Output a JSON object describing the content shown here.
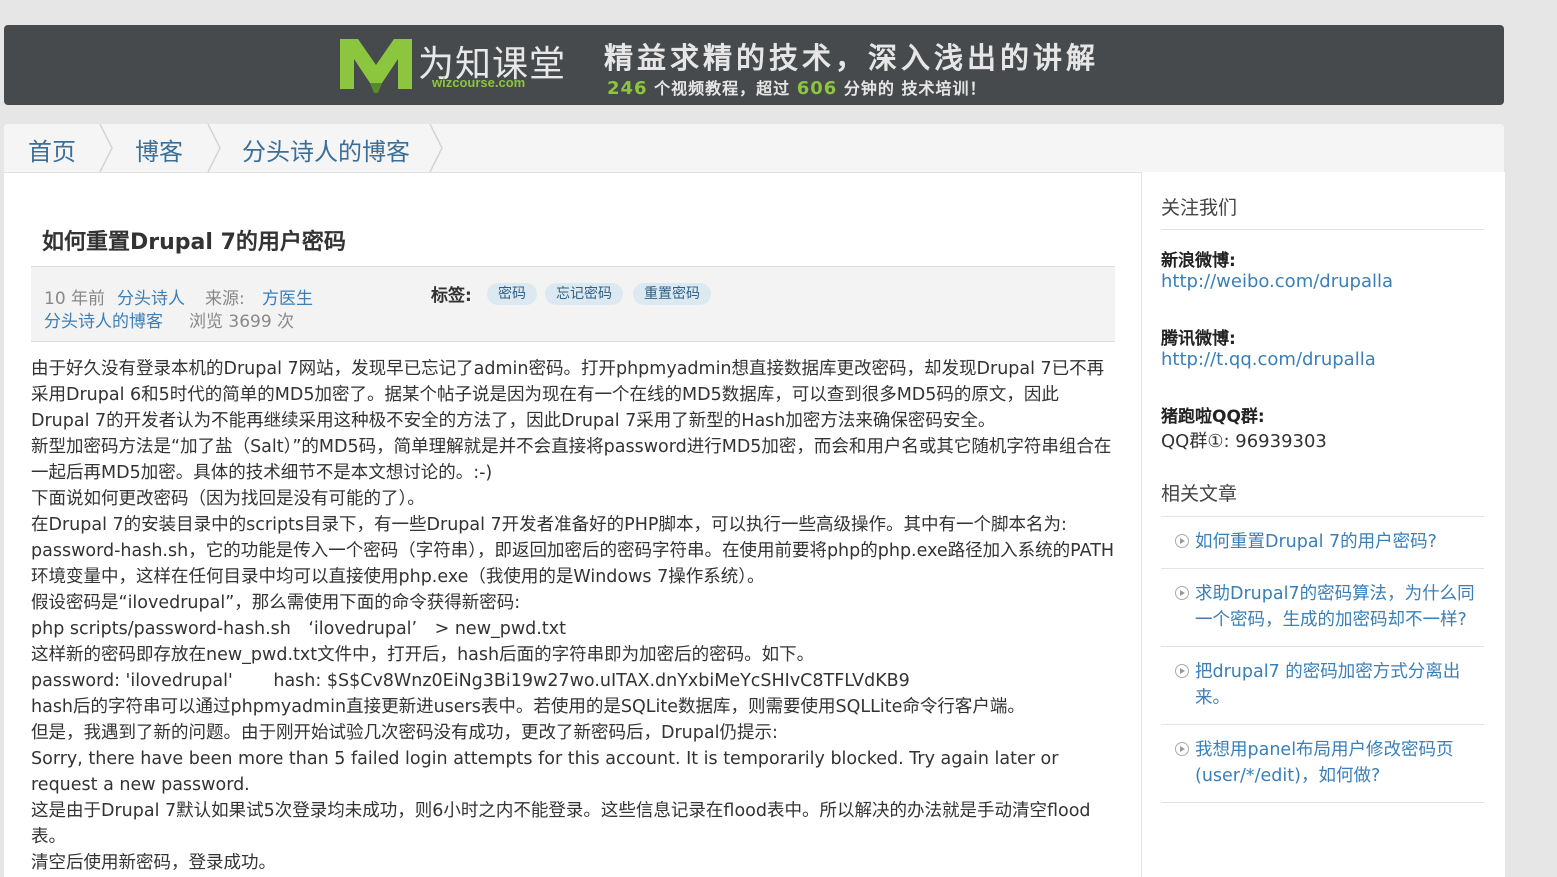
{
  "banner": {
    "logo_cn": "为知课堂",
    "logo_en": "wizcourse.com",
    "slogan": "精益求精的技术，深入浅出的讲解",
    "sub_a": "246",
    "sub_b": " 个视频教程，超过 ",
    "sub_c": "606",
    "sub_d": " 分钟的 技术培训！"
  },
  "breadcrumb": {
    "items": [
      "首页",
      "博客",
      "分头诗人的博客"
    ]
  },
  "article": {
    "title": "如何重置Drupal 7的用户密码",
    "meta": {
      "time": "10 年前",
      "author": "分头诗人",
      "source_label": "来源:",
      "source": "方医生",
      "blog": "分头诗人的博客",
      "views": "浏览 3699 次",
      "tags_label": "标签:",
      "tags": [
        "密码",
        "忘记密码",
        "重置密码"
      ]
    },
    "paragraphs": [
      "由于好久没有登录本机的Drupal 7网站，发现早已忘记了admin密码。打开phpmyadmin想直接数据库更改密码，却发现Drupal 7已不再采用Drupal 6和5时代的简单的MD5加密了。据某个帖子说是因为现在有一个在线的MD5数据库，可以查到很多MD5码的原文，因此Drupal 7的开发者认为不能再继续采用这种极不安全的方法了，因此Drupal 7采用了新型的Hash加密方法来确保密码安全。",
      "新型加密码方法是“加了盐（Salt）”的MD5码，简单理解就是并不会直接将password进行MD5加密，而会和用户名或其它随机字符串组合在一起后再MD5加密。具体的技术细节不是本文想讨论的。:-)",
      "下面说如何更改密码（因为找回是没有可能的了）。",
      "在Drupal 7的安装目录中的scripts目录下，有一些Drupal 7开发者准备好的PHP脚本，可以执行一些高级操作。其中有一个脚本名为: password-hash.sh，它的功能是传入一个密码（字符串），即返回加密后的密码字符串。在使用前要将php的php.exe路径加入系统的PATH环境变量中，这样在任何目录中均可以直接使用php.exe（我使用的是Windows 7操作系统）。",
      "假设密码是“ilovedrupal”，那么需使用下面的命令获得新密码:",
      "php scripts/password-hash.sh　‘ilovedrupal’　> new_pwd.txt",
      "这样新的密码即存放在new_pwd.txt文件中，打开后，hash后面的字符串即为加密后的密码。如下。",
      "password: 'ilovedrupal'　　  hash: $S$Cv8Wnz0EiNg3Bi19w27wo.uITAX.dnYxbiMeYcSHIvC8TFLVdKB9",
      "hash后的字符串可以通过phpmyadmin直接更新进users表中。若使用的是SQLite数据库，则需要使用SQLLite命令行客户端。",
      "但是，我遇到了新的问题。由于刚开始试验几次密码没有成功，更改了新密码后，Drupal仍提示:",
      "Sorry, there have been more than 5 failed login attempts for this account. It is temporarily blocked. Try again later or request a new password.",
      "这是由于Drupal 7默认如果试5次登录均未成功，则6小时之内不能登录。这些信息记录在flood表中。所以解决的办法就是手动清空flood表。",
      "清空后使用新密码，登录成功。"
    ]
  },
  "sidebar": {
    "follow_heading": "关注我们",
    "weibo_label": "新浪微博:",
    "weibo_link": "http://weibo.com/drupalla",
    "tencent_label": "腾讯微博:",
    "tencent_link": "http://t.qq.com/drupalla",
    "qq_label": "猪跑啦QQ群:",
    "qq_text": "QQ群①: 96939303",
    "related_heading": "相关文章",
    "related": [
      "如何重置Drupal 7的用户密码?",
      "求助Drupal7的密码算法，为什么同一个密码，生成的加密码却不一样?",
      "把drupal7 的密码加密方式分离出来。",
      "我想用panel布局用户修改密码页(user/*/edit)，如何做?"
    ]
  },
  "colors": {
    "link": "#3a7fb8",
    "banner_bg": "#474a4c",
    "accent_green": "#8cc63f"
  }
}
